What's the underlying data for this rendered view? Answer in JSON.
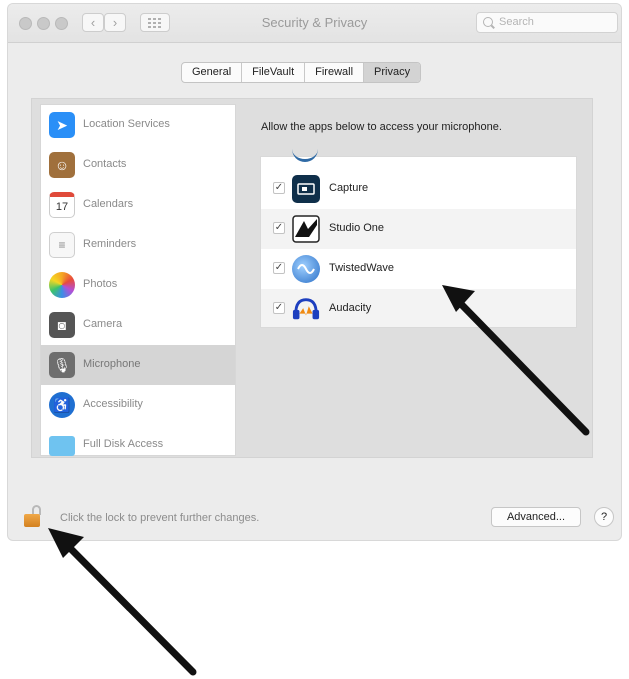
{
  "window": {
    "title": "Security & Privacy",
    "nav_back": "‹",
    "nav_forward": "›",
    "grid_icon": "grid-icon",
    "search_placeholder": "Search"
  },
  "tabs": [
    {
      "label": "General"
    },
    {
      "label": "FileVault"
    },
    {
      "label": "Firewall"
    },
    {
      "label": "Privacy",
      "active": true
    }
  ],
  "sidebar": {
    "items": [
      {
        "label": "Location Services",
        "icon": "location-arrow-icon",
        "color": "#2a8ff7"
      },
      {
        "label": "Contacts",
        "icon": "contacts-book-icon",
        "color": "#a0703c"
      },
      {
        "label": "Calendars",
        "icon": "calendar-icon",
        "color": "#e04a3a"
      },
      {
        "label": "Reminders",
        "icon": "reminders-list-icon",
        "color": "#f2f2f2"
      },
      {
        "label": "Photos",
        "icon": "photos-flower-icon",
        "color": "#f5a623"
      },
      {
        "label": "Camera",
        "icon": "camera-icon",
        "color": "#555555"
      },
      {
        "label": "Microphone",
        "icon": "microphone-icon",
        "color": "#6e6e6e",
        "selected": true
      },
      {
        "label": "Accessibility",
        "icon": "accessibility-icon",
        "color": "#1f6fd1"
      },
      {
        "label": "Full Disk Access",
        "icon": "folder-icon",
        "color": "#6fc3f0"
      }
    ]
  },
  "main": {
    "description": "Allow the apps below to access your microphone.",
    "apps": [
      {
        "name": "Capture",
        "checked": true,
        "icon": "capture-app-icon"
      },
      {
        "name": "Studio One",
        "checked": true,
        "icon": "studio-one-app-icon"
      },
      {
        "name": "TwistedWave",
        "checked": true,
        "icon": "twistedwave-app-icon"
      },
      {
        "name": "Audacity",
        "checked": true,
        "icon": "audacity-app-icon"
      }
    ],
    "check_mark": "✓"
  },
  "footer": {
    "lock_text": "Click the lock to prevent further changes.",
    "advanced_label": "Advanced...",
    "help_label": "?"
  },
  "colors": {
    "window_bg": "#ececec",
    "selected_row": "#d5d5d5",
    "lock_orange": "#e39434",
    "arrow": "#111111"
  }
}
